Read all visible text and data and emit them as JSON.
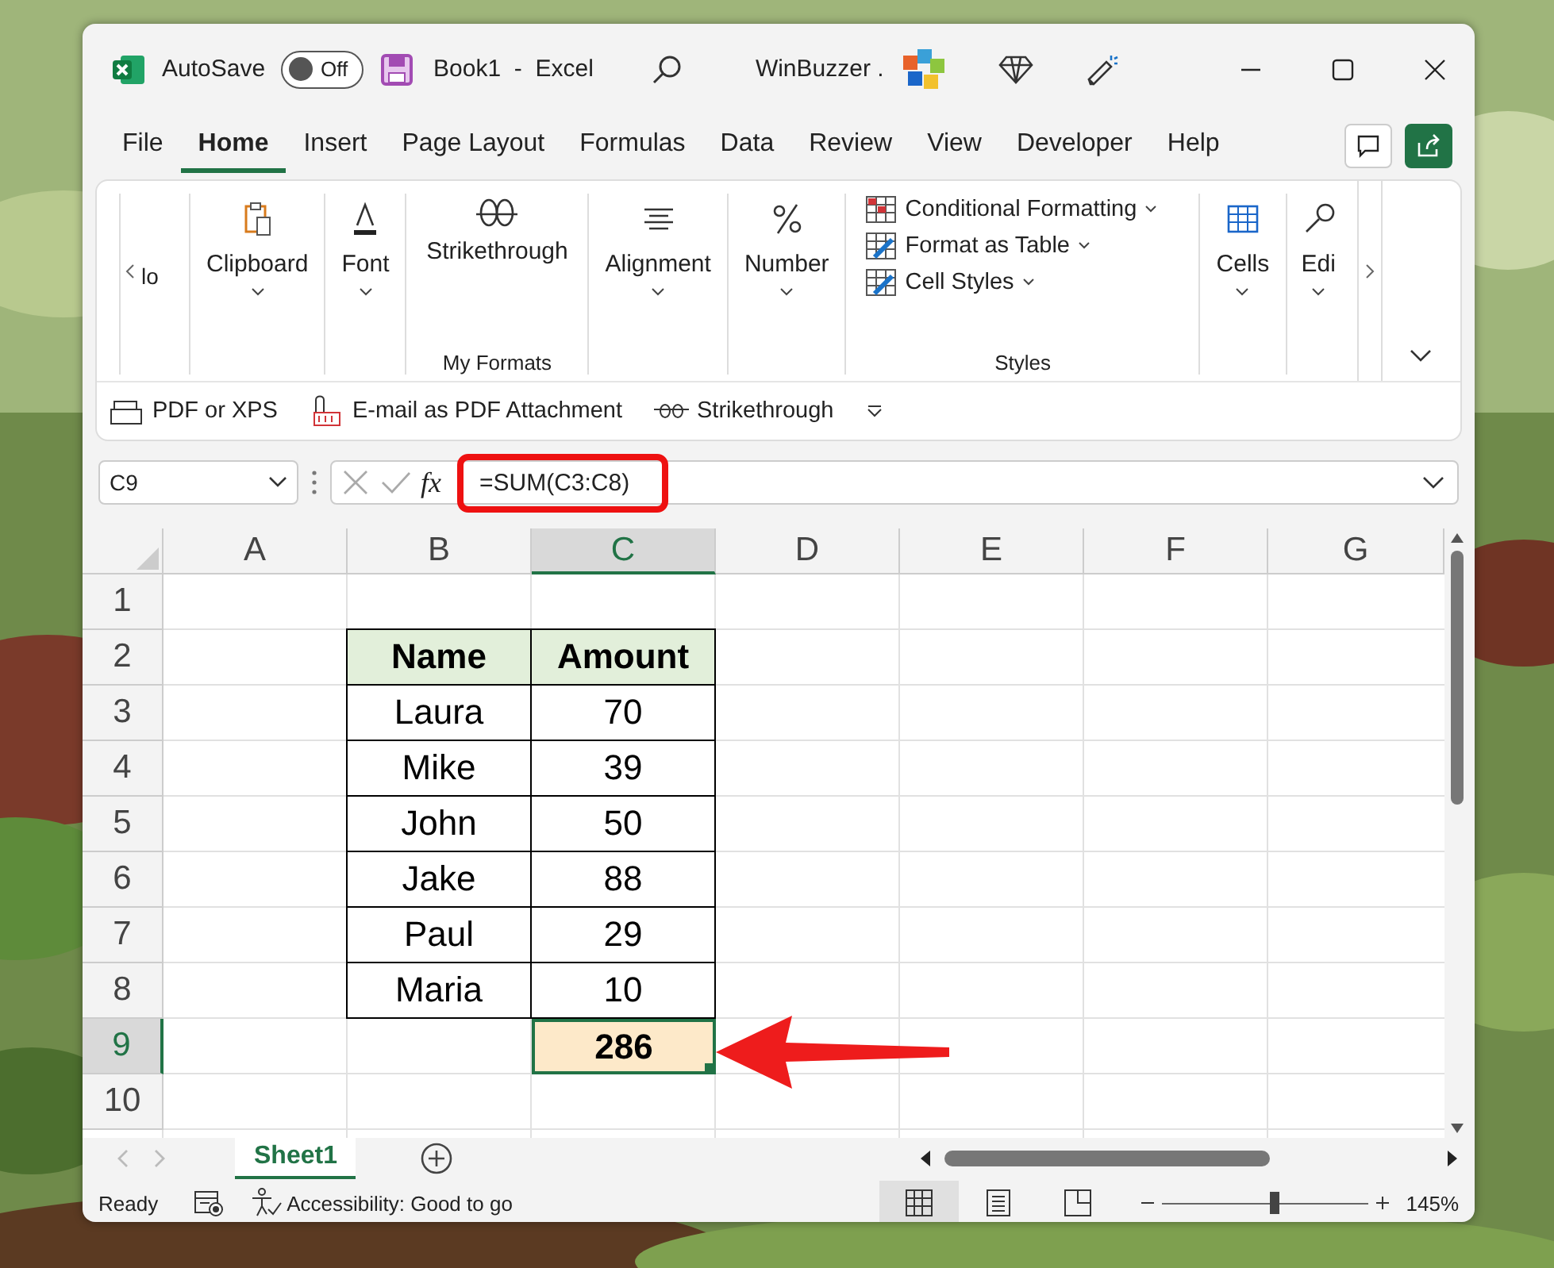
{
  "window": {
    "title": "Book1  -  Excel",
    "autosave": {
      "label": "AutoSave",
      "on": false,
      "state_text": "Off"
    },
    "account": "WinBuzzer ."
  },
  "tabs": [
    {
      "label": "File",
      "selected": false
    },
    {
      "label": "Home",
      "selected": true
    },
    {
      "label": "Insert",
      "selected": false
    },
    {
      "label": "Page Layout",
      "selected": false
    },
    {
      "label": "Formulas",
      "selected": false
    },
    {
      "label": "Data",
      "selected": false
    },
    {
      "label": "Review",
      "selected": false
    },
    {
      "label": "View",
      "selected": false
    },
    {
      "label": "Developer",
      "selected": false
    },
    {
      "label": "Help",
      "selected": false
    }
  ],
  "ribbon": {
    "groups": [
      {
        "kind": "scrolled",
        "label": "lo"
      },
      {
        "kind": "clipboard",
        "label": "Clipboard"
      },
      {
        "kind": "font",
        "label": "Font"
      },
      {
        "kind": "strikethrough",
        "label": "Strikethrough",
        "group_label": "My Formats"
      },
      {
        "kind": "alignment",
        "label": "Alignment"
      },
      {
        "kind": "number",
        "label": "Number"
      },
      {
        "kind": "styles",
        "items": [
          "Conditional Formatting",
          "Format as Table",
          "Cell Styles"
        ],
        "group_label": "Styles"
      },
      {
        "kind": "cells",
        "label": "Cells"
      },
      {
        "kind": "editing",
        "label": "Edi"
      }
    ],
    "quick_access": [
      {
        "kind": "pdf",
        "label": "PDF or XPS"
      },
      {
        "kind": "email",
        "label": "E-mail as PDF Attachment"
      },
      {
        "kind": "strike",
        "label": "Strikethrough"
      }
    ]
  },
  "formula_bar": {
    "name_box": "C9",
    "function_button": "fx",
    "formula": "=SUM(C3:C8)",
    "highlighted": true
  },
  "grid": {
    "columns": [
      {
        "label": "A",
        "selected": false
      },
      {
        "label": "B",
        "selected": false
      },
      {
        "label": "C",
        "selected": true
      },
      {
        "label": "D",
        "selected": false
      },
      {
        "label": "E",
        "selected": false
      },
      {
        "label": "F",
        "selected": false
      },
      {
        "label": "G",
        "selected": false
      }
    ],
    "rows": [
      {
        "label": "1",
        "selected": false,
        "cells": [
          null,
          null,
          null,
          null,
          null,
          null,
          null
        ]
      },
      {
        "label": "2",
        "selected": false,
        "cells": [
          null,
          {
            "text": "Name",
            "kind": "header",
            "selected": false
          },
          {
            "text": "Amount",
            "kind": "header",
            "selected": false
          },
          null,
          null,
          null,
          null
        ]
      },
      {
        "label": "3",
        "selected": false,
        "cells": [
          null,
          {
            "text": "Laura",
            "kind": "value",
            "selected": false
          },
          {
            "text": "70",
            "kind": "value",
            "selected": false
          },
          null,
          null,
          null,
          null
        ]
      },
      {
        "label": "4",
        "selected": false,
        "cells": [
          null,
          {
            "text": "Mike",
            "kind": "value",
            "selected": false
          },
          {
            "text": "39",
            "kind": "value",
            "selected": false
          },
          null,
          null,
          null,
          null
        ]
      },
      {
        "label": "5",
        "selected": false,
        "cells": [
          null,
          {
            "text": "John",
            "kind": "value",
            "selected": false
          },
          {
            "text": "50",
            "kind": "value",
            "selected": false
          },
          null,
          null,
          null,
          null
        ]
      },
      {
        "label": "6",
        "selected": false,
        "cells": [
          null,
          {
            "text": "Jake",
            "kind": "value",
            "selected": false
          },
          {
            "text": "88",
            "kind": "value",
            "selected": false
          },
          null,
          null,
          null,
          null
        ]
      },
      {
        "label": "7",
        "selected": false,
        "cells": [
          null,
          {
            "text": "Paul",
            "kind": "value",
            "selected": false
          },
          {
            "text": "29",
            "kind": "value",
            "selected": false
          },
          null,
          null,
          null,
          null
        ]
      },
      {
        "label": "8",
        "selected": false,
        "cells": [
          null,
          {
            "text": "Maria",
            "kind": "value",
            "selected": false
          },
          {
            "text": "10",
            "kind": "value",
            "selected": false
          },
          null,
          null,
          null,
          null
        ]
      },
      {
        "label": "9",
        "selected": true,
        "cells": [
          null,
          null,
          {
            "text": "286",
            "kind": "total",
            "selected": true
          },
          null,
          null,
          null,
          null
        ]
      },
      {
        "label": "10",
        "selected": false,
        "cells": [
          null,
          null,
          null,
          null,
          null,
          null,
          null
        ]
      }
    ],
    "annotations": [
      {
        "kind": "arrow"
      }
    ]
  },
  "sheet_tabs": [
    {
      "label": "Sheet1",
      "selected": true
    }
  ],
  "status_bar": {
    "status": "Ready",
    "accessibility": "Accessibility: Good to go",
    "views": [
      {
        "kind": "normal",
        "selected": true
      },
      {
        "kind": "page-layout",
        "selected": false
      },
      {
        "kind": "page-break",
        "selected": false
      }
    ],
    "zoom": {
      "level": 0.55,
      "reading": "145%"
    }
  }
}
